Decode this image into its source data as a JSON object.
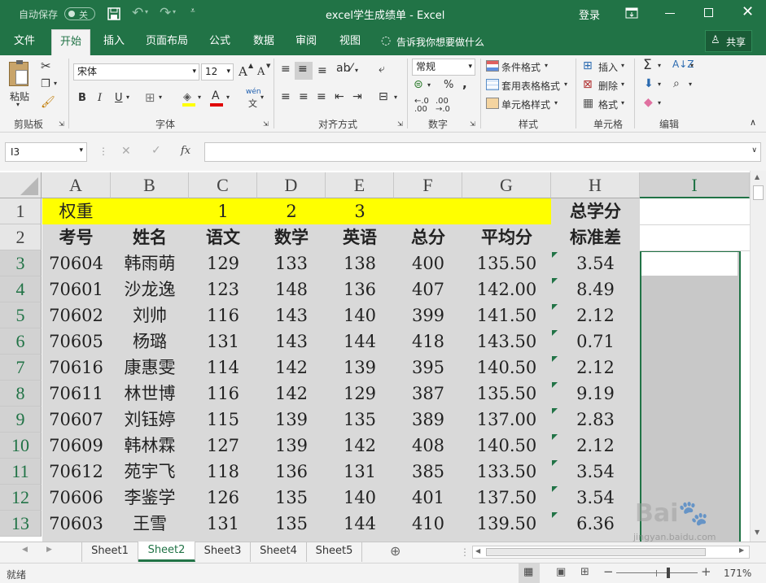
{
  "titlebar": {
    "autosave_label": "自动保存",
    "autosave_state": "关",
    "doc_title": "excel学生成绩单 - Excel",
    "signin": "登录"
  },
  "tabs": [
    "文件",
    "开始",
    "插入",
    "页面布局",
    "公式",
    "数据",
    "审阅",
    "视图"
  ],
  "active_tab": "开始",
  "tell_me": "告诉我你想要做什么",
  "share": "共享",
  "ribbon": {
    "clipboard": {
      "paste": "粘贴",
      "label": "剪贴板"
    },
    "font": {
      "name": "宋体",
      "size": "12",
      "label": "字体",
      "bold": "B",
      "italic": "I",
      "underline": "U",
      "grow": "A",
      "shrink": "A",
      "phonetic": "wén"
    },
    "alignment": {
      "label": "对齐方式"
    },
    "number": {
      "format": "常规",
      "label": "数字",
      "percent": "%",
      "comma": ","
    },
    "styles": {
      "conditional": "条件格式",
      "table": "套用表格格式",
      "cell": "单元格样式",
      "label": "样式"
    },
    "cells": {
      "insert": "插入",
      "delete": "删除",
      "format": "格式",
      "label": "单元格"
    },
    "editing": {
      "label": "编辑"
    }
  },
  "formula_bar": {
    "name_box": "I3",
    "fx": "fx",
    "value": ""
  },
  "columns": [
    "A",
    "B",
    "C",
    "D",
    "E",
    "F",
    "G",
    "H",
    "I"
  ],
  "rows": [
    "1",
    "2",
    "3",
    "4",
    "5",
    "6",
    "7",
    "8",
    "9",
    "10",
    "11",
    "12",
    "13"
  ],
  "sheet": {
    "row1": [
      "权重",
      "",
      "1",
      "2",
      "3",
      "",
      "",
      "总学分"
    ],
    "row2": [
      "考号",
      "姓名",
      "语文",
      "数学",
      "英语",
      "总分",
      "平均分",
      "标准差"
    ],
    "data": [
      [
        "70604",
        "韩雨萌",
        "129",
        "133",
        "138",
        "400",
        "135.50",
        "3.54"
      ],
      [
        "70601",
        "沙龙逸",
        "123",
        "148",
        "136",
        "407",
        "142.00",
        "8.49"
      ],
      [
        "70602",
        "刘帅",
        "116",
        "143",
        "140",
        "399",
        "141.50",
        "2.12"
      ],
      [
        "70605",
        "杨璐",
        "131",
        "143",
        "144",
        "418",
        "143.50",
        "0.71"
      ],
      [
        "70616",
        "康惠雯",
        "114",
        "142",
        "139",
        "395",
        "140.50",
        "2.12"
      ],
      [
        "70611",
        "林世博",
        "116",
        "142",
        "129",
        "387",
        "135.50",
        "9.19"
      ],
      [
        "70607",
        "刘钰婷",
        "115",
        "139",
        "135",
        "389",
        "137.00",
        "2.83"
      ],
      [
        "70609",
        "韩林霖",
        "127",
        "139",
        "142",
        "408",
        "140.50",
        "2.12"
      ],
      [
        "70612",
        "苑宇飞",
        "118",
        "136",
        "131",
        "385",
        "133.50",
        "3.54"
      ],
      [
        "70606",
        "李鉴学",
        "126",
        "135",
        "140",
        "401",
        "137.50",
        "3.54"
      ],
      [
        "70603",
        "王雪",
        "131",
        "135",
        "144",
        "410",
        "139.50",
        "6.36"
      ]
    ]
  },
  "sheet_tabs": [
    "Sheet1",
    "Sheet2",
    "Sheet3",
    "Sheet4",
    "Sheet5"
  ],
  "active_sheet": "Sheet2",
  "status": {
    "ready": "就绪",
    "zoom": "171%"
  },
  "watermark": {
    "site": "jingyan.baidu.com"
  },
  "colors": {
    "excel_green": "#217346",
    "highlight_yellow": "#ffff00",
    "selection_gray": "#d9d9d9"
  }
}
